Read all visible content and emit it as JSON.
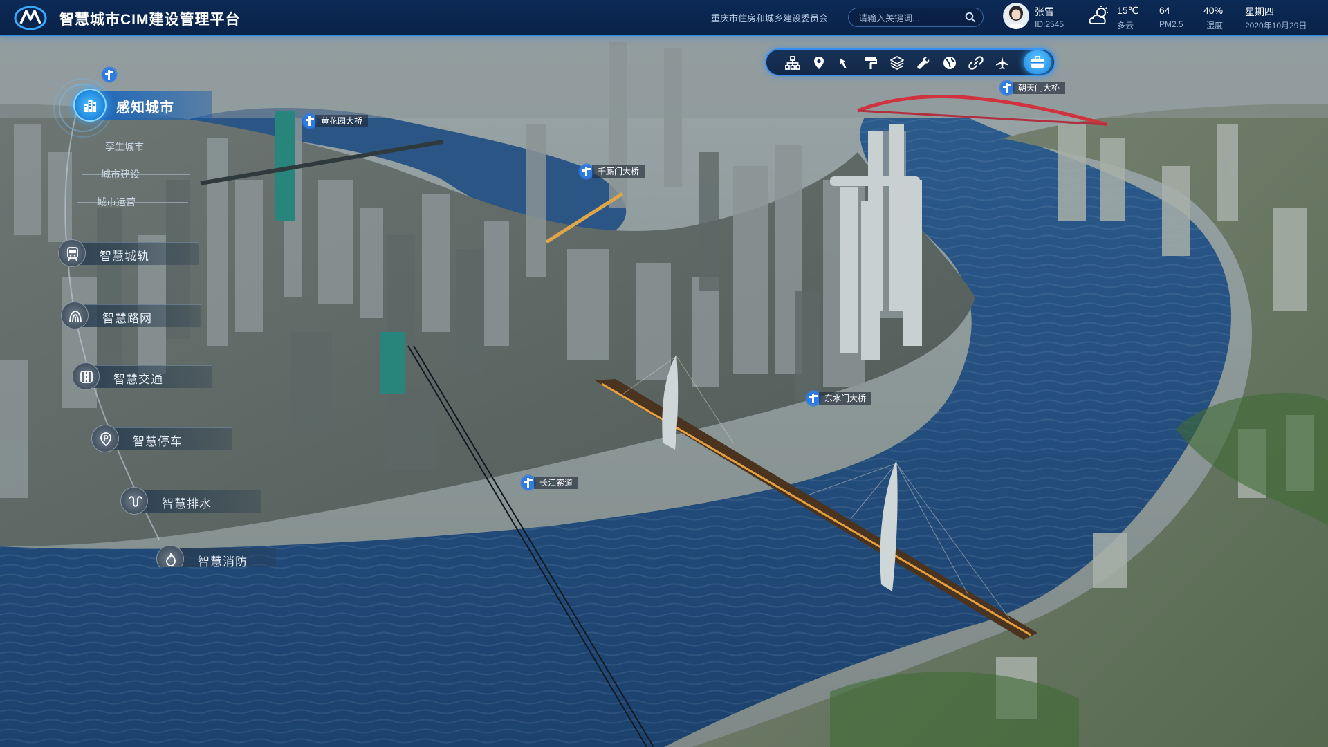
{
  "header": {
    "title": "智慧城市CIM建设管理平台",
    "org": "重庆市住房和城乡建设委员会",
    "search_placeholder": "请输入关键词...",
    "user": {
      "name": "张雪",
      "id": "ID:2545"
    },
    "weather": {
      "temp": "15℃",
      "desc": "多云"
    },
    "pm": {
      "value": "64",
      "label": "PM2.5"
    },
    "humidity": {
      "value": "40%",
      "label": "湿度"
    },
    "date": {
      "weekday": "星期四",
      "date": "2020年10月29日"
    }
  },
  "toolbar": {
    "tools": [
      "org-chart-icon",
      "location-pin-icon",
      "pointer-arrow-icon",
      "paint-roller-icon",
      "layers-icon",
      "wrench-icon",
      "globe-icon",
      "link-icon",
      "aircraft-icon",
      "briefcase-icon"
    ],
    "active": "briefcase-icon"
  },
  "left_menu": {
    "primary": "感知城市",
    "sub_items": [
      "孪生城市",
      "城市建设",
      "城市运营"
    ],
    "items": [
      {
        "label": "智慧城轨",
        "icon": "metro-train-icon"
      },
      {
        "label": "智慧路网",
        "icon": "road-network-icon"
      },
      {
        "label": "智慧交通",
        "icon": "traffic-light-icon"
      },
      {
        "label": "智慧停车",
        "icon": "parking-pin-icon"
      },
      {
        "label": "智慧排水",
        "icon": "drainage-icon"
      },
      {
        "label": "智慧消防",
        "icon": "fire-control-icon"
      }
    ]
  },
  "map_labels": [
    "黄花园大桥",
    "千厮门大桥",
    "朝天门大桥",
    "东水门大桥",
    "长江索道"
  ],
  "colors": {
    "accent": "#2b87d8",
    "primary_active": "#1e86dd",
    "river": "#1d4a7a"
  }
}
